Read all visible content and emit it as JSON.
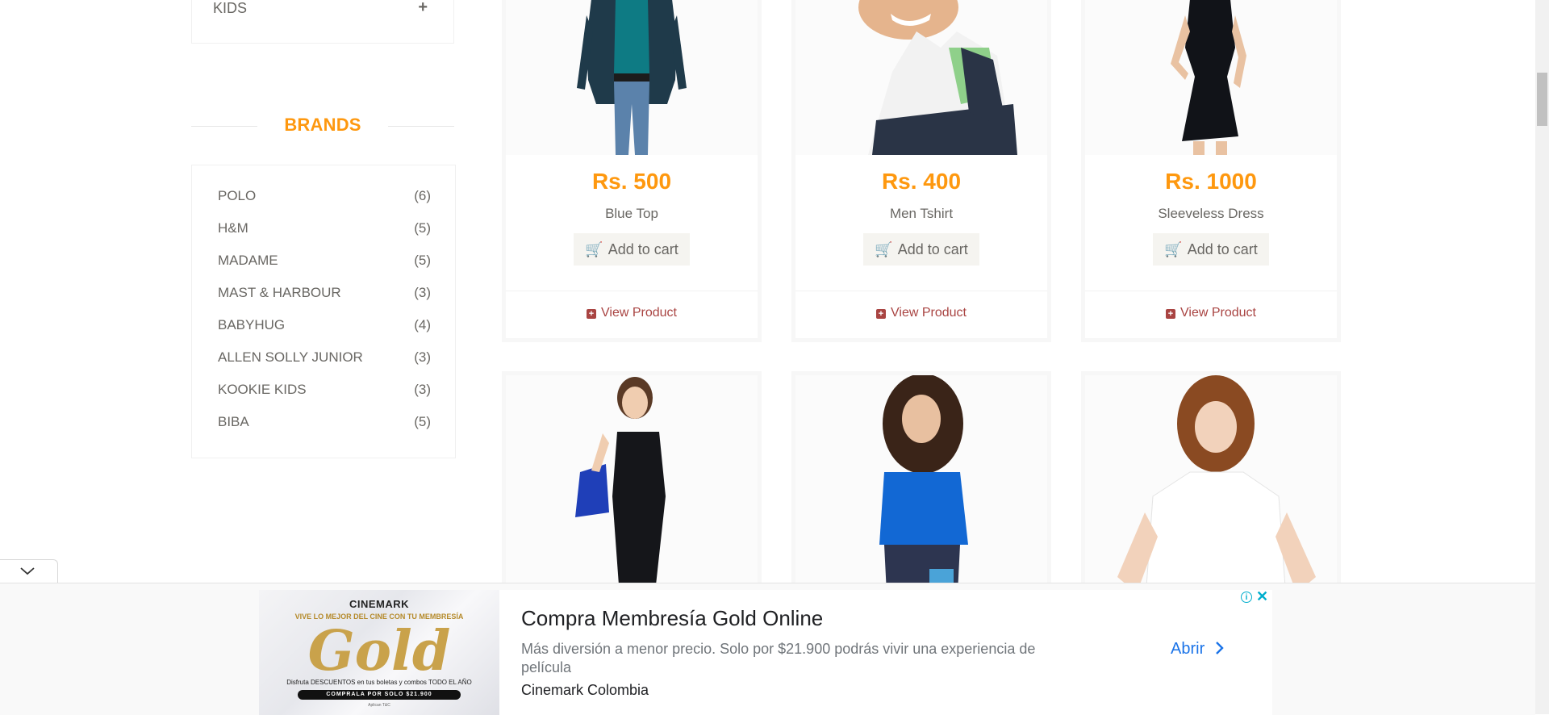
{
  "sidebar": {
    "kids_label": "KIDS",
    "expand_symbol": "+",
    "brands_title": "BRANDS",
    "brands": [
      {
        "name": "POLO",
        "count": "(6)"
      },
      {
        "name": "H&M",
        "count": "(5)"
      },
      {
        "name": "MADAME",
        "count": "(5)"
      },
      {
        "name": "MAST & HARBOUR",
        "count": "(3)"
      },
      {
        "name": "BABYHUG",
        "count": "(4)"
      },
      {
        "name": "ALLEN SOLLY JUNIOR",
        "count": "(3)"
      },
      {
        "name": "KOOKIE KIDS",
        "count": "(3)"
      },
      {
        "name": "BIBA",
        "count": "(5)"
      }
    ]
  },
  "products": [
    {
      "price": "Rs. 500",
      "name": "Blue Top",
      "add_label": "Add to cart",
      "view_label": "View Product"
    },
    {
      "price": "Rs. 400",
      "name": "Men Tshirt",
      "add_label": "Add to cart",
      "view_label": "View Product"
    },
    {
      "price": "Rs. 1000",
      "name": "Sleeveless Dress",
      "add_label": "Add to cart",
      "view_label": "View Product"
    }
  ],
  "ad": {
    "image_brand": "CINEMARK",
    "image_tagline": "VIVE LO MEJOR DEL CINE CON TU MEMBRESÍA",
    "image_gold": "Gold",
    "image_discount": "Disfruta DESCUENTOS en tus boletas y combos TODO EL AÑO",
    "image_buy": "COMPRALA POR SOLO $21.900",
    "image_fine": "Aplican T&C",
    "title": "Compra Membresía Gold Online",
    "description": "Más diversión a menor precio. Solo por $21.900 podrás vivir una experiencia de película",
    "advertiser": "Cinemark Colombia",
    "open_label": "Abrir",
    "info_symbol": "i",
    "close_symbol": "✕"
  },
  "colors": {
    "accent": "#fe980f",
    "view_link": "#a94442",
    "ad_link": "#1a73e8"
  }
}
